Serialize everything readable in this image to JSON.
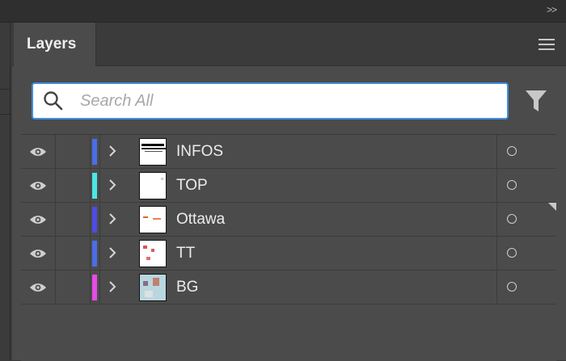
{
  "panel": {
    "tab_label": "Layers",
    "collapse_glyph": ">>"
  },
  "search": {
    "placeholder": "Search All",
    "value": ""
  },
  "colors": {
    "accent": "#3e8ee0"
  },
  "layers": [
    {
      "name": "INFOS",
      "color": "#4a6ee6",
      "visible": true
    },
    {
      "name": "TOP",
      "color": "#4de5e5",
      "visible": true
    },
    {
      "name": "Ottawa",
      "color": "#4c4ce6",
      "visible": true
    },
    {
      "name": "TT",
      "color": "#4a6ee6",
      "visible": true
    },
    {
      "name": "BG",
      "color": "#e54ce6",
      "visible": true
    }
  ]
}
